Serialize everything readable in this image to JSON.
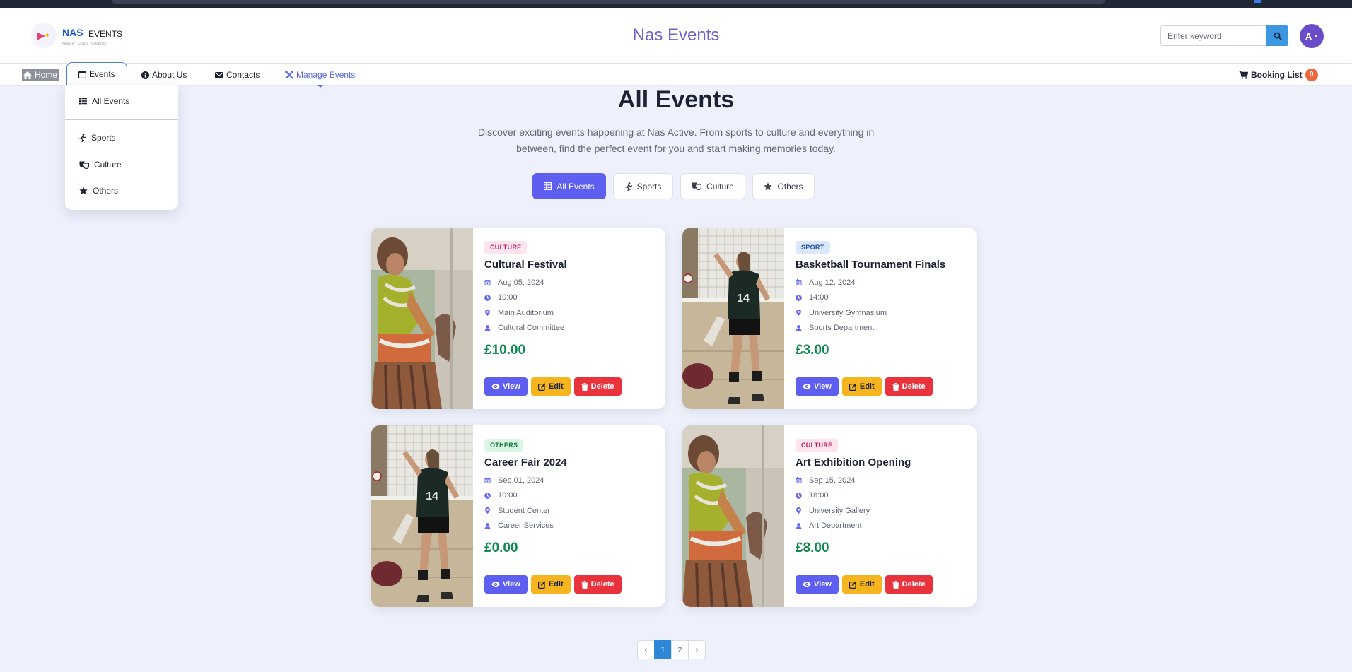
{
  "brand": {
    "nas": "NAS",
    "events": "EVENTS",
    "tagline": "Register · Create · Celebrate"
  },
  "header": {
    "site_title": "Nas Events",
    "avatar_initial": "A"
  },
  "search": {
    "placeholder": "Enter keyword"
  },
  "nav": {
    "home": "Home",
    "events": "Events",
    "about": "About Us",
    "contacts": "Contacts",
    "manage": "Manage Events",
    "booking_list": "Booking List",
    "booking_count": "0"
  },
  "dropdown": {
    "all_events": "All Events",
    "sports": "Sports",
    "culture": "Culture",
    "others": "Others"
  },
  "main": {
    "heading": "All Events",
    "intro": "Discover exciting events happening at Nas Active. From sports to culture and everything in between, find the perfect event for you and start making memories today."
  },
  "filters": {
    "all": "All Events",
    "sports": "Sports",
    "culture": "Culture",
    "others": "Others",
    "active": "All Events"
  },
  "events": [
    {
      "tag": "CULTURE",
      "title": "Cultural Festival",
      "date": "Aug 05, 2024",
      "time": "10:00",
      "location": "Main Auditorium",
      "organizer": "Cultural Committee",
      "price": "£10.00"
    },
    {
      "tag": "SPORT",
      "title": "Basketball Tournament Finals",
      "date": "Aug 12, 2024",
      "time": "14:00",
      "location": "University Gymnasium",
      "organizer": "Sports Department",
      "price": "£3.00"
    },
    {
      "tag": "OTHERS",
      "title": "Career Fair 2024",
      "date": "Sep 01, 2024",
      "time": "10:00",
      "location": "Student Center",
      "organizer": "Career Services",
      "price": "£0.00"
    },
    {
      "tag": "CULTURE",
      "title": "Art Exhibition Opening",
      "date": "Sep 15, 2024",
      "time": "18:00",
      "location": "University Gallery",
      "organizer": "Art Department",
      "price": "£8.00"
    }
  ],
  "actions": {
    "view": "View",
    "edit": "Edit",
    "delete": "Delete"
  },
  "pagination": {
    "prev": "‹",
    "pages": [
      "1",
      "2"
    ],
    "next": "›",
    "current": "1"
  },
  "colors": {
    "accent": "#5e5ef0",
    "price": "#0f8a4e",
    "edit": "#f6b51f",
    "delete": "#e8323c",
    "badge": "#f0663c"
  }
}
